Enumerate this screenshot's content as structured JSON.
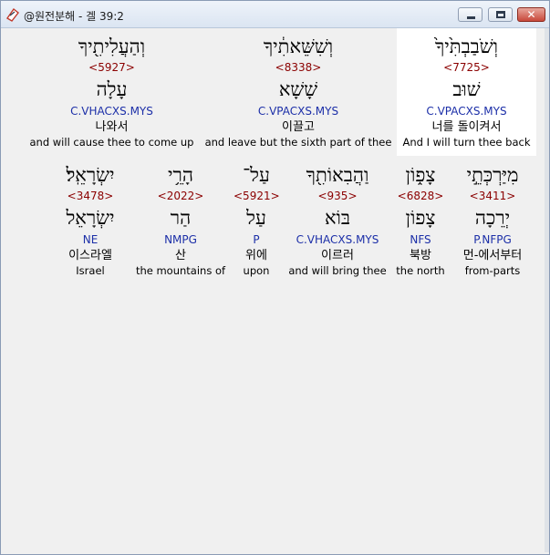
{
  "window": {
    "title": "@원전분해 - 겔 39:2",
    "minimize_label": "",
    "maximize_label": "",
    "close_label": "✕"
  },
  "rows": [
    {
      "words": [
        {
          "hebrew": "וְהַעֲלִיתִ֖יךָ",
          "strong": "<5927>",
          "lemma": "עָלָה",
          "parse": "C.VHACXS.MYS",
          "korean": "나와서",
          "english": "and will cause thee to come up",
          "highlight": false
        },
        {
          "hebrew": "וְשִׁשֵּׁאתִ֔יךָ",
          "strong": "<8338>",
          "lemma": "שָׁשָׁא",
          "parse": "C.VPACXS.MYS",
          "korean": "이끌고",
          "english": "and leave but the sixth part of thee",
          "highlight": false
        },
        {
          "hebrew": "וְשֹׁבַבְתִּ֙יךָ֙",
          "strong": "<7725>",
          "lemma": "שׁוּב",
          "parse": "C.VPACXS.MYS",
          "korean": "너를 돌이켜서",
          "english": "And I will turn thee back",
          "highlight": true
        }
      ]
    },
    {
      "words": [
        {
          "hebrew": "יִשְׂרָאֵֽל׃",
          "strong": "<3478>",
          "lemma": "יִשְׂרָאֵל",
          "parse": "NE",
          "korean": "이스라엘",
          "english": "Israel",
          "highlight": false
        },
        {
          "hebrew": "הָרֵ֥י",
          "strong": "<2022>",
          "lemma": "הַר",
          "parse": "NMPG",
          "korean": "산",
          "english": "the mountains of",
          "highlight": false
        },
        {
          "hebrew": "עַל־",
          "strong": "<5921>",
          "lemma": "עַל",
          "parse": "P",
          "korean": "위에",
          "english": "upon",
          "highlight": false
        },
        {
          "hebrew": "וַהֲבִאוֹתִ֖ךָ",
          "strong": "<935>",
          "lemma": "בּוֹא",
          "parse": "C.VHACXS.MYS",
          "korean": "이르러",
          "english": "and will bring thee",
          "highlight": false
        },
        {
          "hebrew": "צָפ֑וֹן",
          "strong": "<6828>",
          "lemma": "צָפוֹן",
          "parse": "NFS",
          "korean": "북방",
          "english": "the north",
          "highlight": false
        },
        {
          "hebrew": "מִיַּרְכְּתֵ֣י",
          "strong": "<3411>",
          "lemma": "יְרֵכָה",
          "parse": "P.NFPG",
          "korean": "먼-에서부터",
          "english": "from-parts",
          "highlight": false
        }
      ]
    }
  ]
}
